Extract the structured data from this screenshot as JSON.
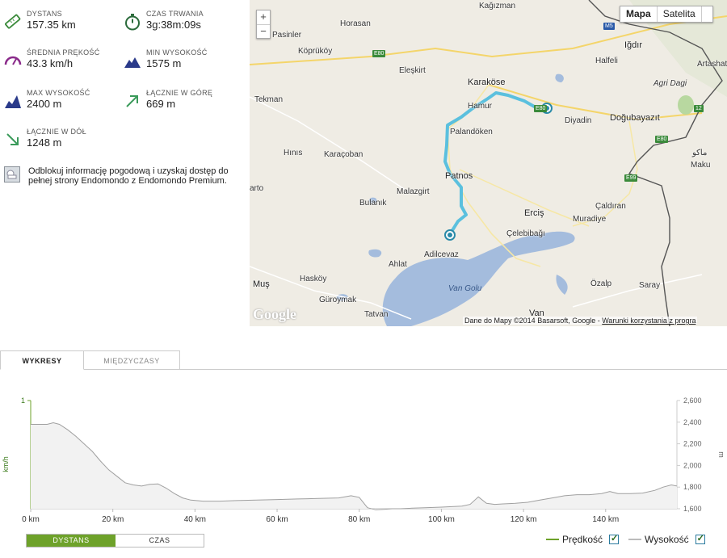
{
  "stats": [
    {
      "id": "distance",
      "label": "DYSTANS",
      "value": "157.35 km",
      "icon": "ruler-icon"
    },
    {
      "id": "duration",
      "label": "CZAS TRWANIA",
      "value": "3g:38m:09s",
      "icon": "stopwatch-icon"
    },
    {
      "id": "avg-speed",
      "label": "ŚREDNIA PRĘKOŚĆ",
      "value": "43.3 km/h",
      "icon": "speedometer-icon"
    },
    {
      "id": "min-alt",
      "label": "MIN WYSOKOŚĆ",
      "value": "1575 m",
      "icon": "mountain-low-icon"
    },
    {
      "id": "max-alt",
      "label": "MAX WYSOKOŚĆ",
      "value": "2400 m",
      "icon": "mountain-high-icon"
    },
    {
      "id": "ascent",
      "label": "ŁĄCZNIE W GÓRĘ",
      "value": "669 m",
      "icon": "arrow-up-right-icon"
    },
    {
      "id": "descent",
      "label": "ŁĄCZNIE W DÓŁ",
      "value": "1248 m",
      "icon": "arrow-down-right-icon"
    }
  ],
  "promo": {
    "text": "Odblokuj informację pogodową i uzyskaj dostęp do pełnej strony Endomondo z Endomondo Premium.",
    "icon": "weather-icon"
  },
  "map": {
    "type_buttons": [
      "Mapa",
      "Satelita"
    ],
    "zoom_in": "+",
    "zoom_out": "−",
    "logo": "Google",
    "attribution": "Dane do Mapy ©2014 Basarsoft, Google -",
    "terms_link": "Warunki korzystania z progra",
    "labels": [
      "Kağızman",
      "Pasinler",
      "Horasan",
      "Köprüköy",
      "Iğdır",
      "Halfeli",
      "Artashat",
      "Eleşkirt",
      "Karaköse",
      "Agri Dagi",
      "Tekman",
      "Hamur",
      "Diyadin",
      "Doğubayazıt",
      "Palandöken",
      "Hınıs",
      "Karaçoban",
      "ماكو",
      "Maku",
      "Patnos",
      "arto",
      "Malazgirt",
      "Çaldıran",
      "Bulanık",
      "Erciş",
      "Muradiye",
      "Çelebibağı",
      "Adilcevaz",
      "Ahlat",
      "Van Golu",
      "Hasköy",
      "Muş",
      "Özalp",
      "Saray",
      "Güroymak",
      "Tatvan",
      "Van"
    ],
    "shields": [
      "M5",
      "E80",
      "E80",
      "E99",
      "E80",
      "12"
    ]
  },
  "tabs": {
    "charts": "WYKRESY",
    "splits": "MIĘDZYCZASY"
  },
  "chart_data": {
    "type": "line",
    "xlabel": "",
    "x_ticks": [
      "0 km",
      "20 km",
      "40 km",
      "60 km",
      "80 km",
      "100 km",
      "120 km",
      "140 km"
    ],
    "x_tick_values": [
      0,
      20,
      40,
      60,
      80,
      100,
      120,
      140
    ],
    "xlim": [
      0,
      157.35
    ],
    "left_axis": {
      "label": "km/h",
      "ticks": [
        "1"
      ],
      "ylim": [
        0,
        1
      ]
    },
    "right_axis": {
      "label": "m",
      "ticks": [
        "1,600",
        "1,800",
        "2,000",
        "2,200",
        "2,400",
        "2,600"
      ],
      "tick_values": [
        1600,
        1800,
        2000,
        2200,
        2400,
        2600
      ],
      "ylim": [
        1600,
        2600
      ]
    },
    "series": [
      {
        "name": "Wysokość",
        "color": "#a0a0a0",
        "fill": "#f2f2f2",
        "x": [
          0,
          4,
          5.5,
          7,
          9,
          11,
          13,
          15,
          17,
          19,
          21,
          23,
          25,
          27,
          29,
          31,
          33,
          35,
          37,
          39,
          42,
          46,
          50,
          55,
          60,
          65,
          70,
          75,
          78,
          80,
          82,
          84,
          86,
          88,
          90,
          93,
          96,
          100,
          103,
          105,
          107,
          109,
          111,
          113,
          115,
          118,
          121,
          124,
          127,
          130,
          133,
          136,
          139,
          141,
          143,
          146,
          149,
          152,
          154,
          156,
          157.35
        ],
        "y": [
          2380,
          2380,
          2395,
          2380,
          2330,
          2270,
          2200,
          2130,
          2040,
          1960,
          1900,
          1840,
          1820,
          1810,
          1825,
          1830,
          1790,
          1740,
          1700,
          1680,
          1670,
          1670,
          1675,
          1680,
          1685,
          1690,
          1695,
          1700,
          1720,
          1705,
          1610,
          1590,
          1595,
          1600,
          1600,
          1605,
          1610,
          1615,
          1620,
          1625,
          1640,
          1710,
          1650,
          1640,
          1645,
          1650,
          1660,
          1680,
          1700,
          1720,
          1730,
          1730,
          1740,
          1760,
          1740,
          1740,
          1745,
          1770,
          1800,
          1820,
          1810
        ]
      },
      {
        "name": "Prędkość",
        "color": "#6ea22a",
        "x": [],
        "y": []
      }
    ]
  },
  "bottom": {
    "toggle": [
      "DYSTANS",
      "CZAS"
    ],
    "legend": [
      {
        "name": "Prędkość",
        "color": "#6ea22a"
      },
      {
        "name": "Wysokość",
        "color": "#bbbbbb"
      }
    ]
  }
}
